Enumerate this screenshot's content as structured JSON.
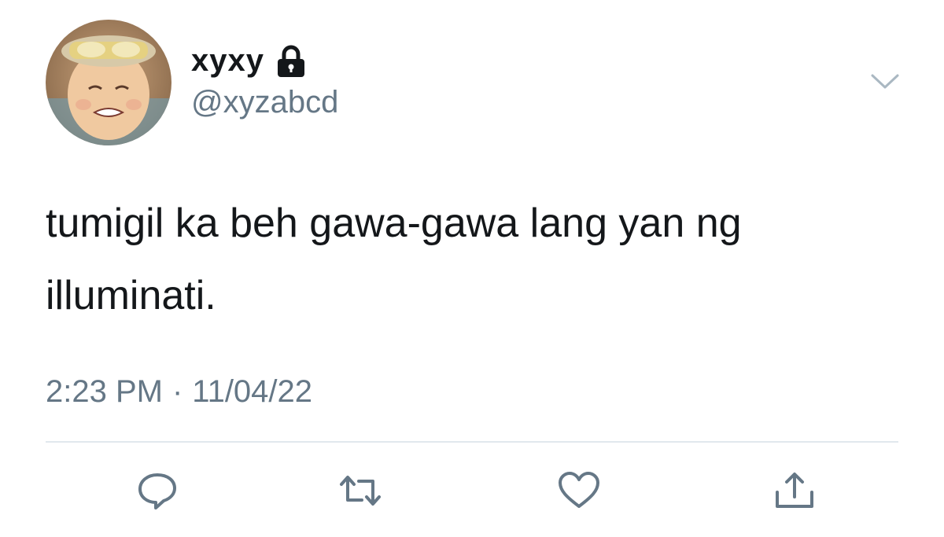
{
  "user": {
    "display_name": "xyxy",
    "handle": "@xyzabcd",
    "protected_icon": "lock-icon"
  },
  "tweet": {
    "text": "tumigil ka beh gawa-gawa lang yan ng illuminati.",
    "time": "2:23 PM",
    "separator": "·",
    "date": "11/04/22"
  },
  "actions": [
    {
      "name": "reply",
      "icon": "speech-bubble-icon"
    },
    {
      "name": "retweet",
      "icon": "retweet-icon"
    },
    {
      "name": "like",
      "icon": "heart-icon"
    },
    {
      "name": "share",
      "icon": "share-icon"
    }
  ],
  "colors": {
    "text_primary": "#14171a",
    "text_secondary": "#657786",
    "divider": "#e1e8ed",
    "icon": "#657786"
  }
}
